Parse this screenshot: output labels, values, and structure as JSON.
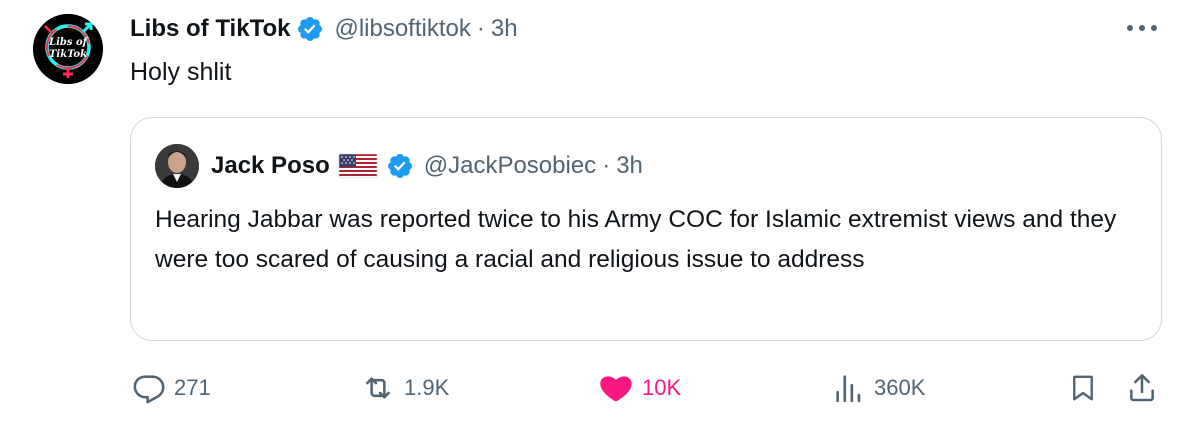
{
  "tweet": {
    "author": {
      "display_name": "Libs of TikTok",
      "handle": "@libsoftiktok",
      "separator": "·",
      "time": "3h",
      "avatar_text_line1": "Libs of",
      "avatar_text_line2": "TikTok"
    },
    "text": "Holy shlit",
    "more_icon": "more-dots-icon"
  },
  "quoted": {
    "author": {
      "display_name": "Jack Poso",
      "flag_icon": "us-flag-icon",
      "handle": "@JackPosobiec",
      "separator": "·",
      "time": "3h"
    },
    "text": "Hearing Jabbar was reported twice to his Army COC for Islamic extremist views and they were too scared of causing a racial and religious issue to address"
  },
  "actions": {
    "replies": "271",
    "reposts": "1.9K",
    "likes": "10K",
    "views": "360K",
    "liked": true
  },
  "colors": {
    "verified": "#1d9bf0",
    "secondary_text": "#536471",
    "like_pink": "#f91880",
    "border": "#cfd9de"
  }
}
